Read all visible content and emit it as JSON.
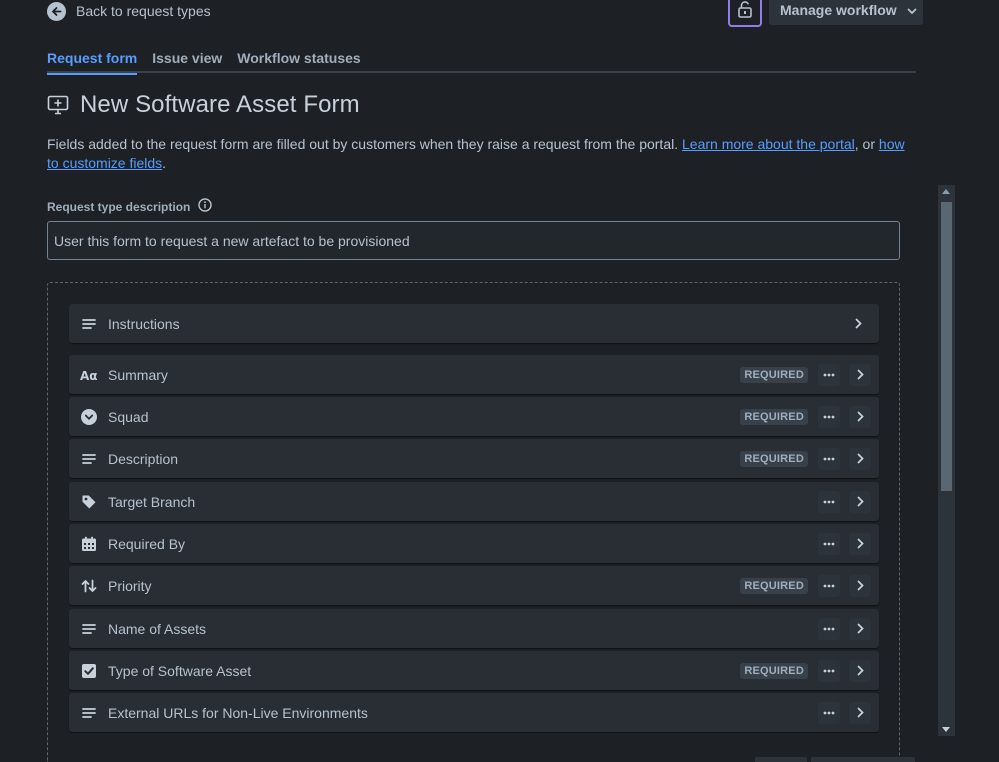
{
  "header": {
    "back_label": "Back to request types",
    "manage_workflow_label": "Manage workflow"
  },
  "tabs": [
    {
      "label": "Request form",
      "active": true
    },
    {
      "label": "Issue view",
      "active": false
    },
    {
      "label": "Workflow statuses",
      "active": false
    }
  ],
  "page": {
    "title": "New Software Asset Form",
    "intro_text": "Fields added to the request form are filled out by customers when they raise a request from the portal. ",
    "intro_link1": "Learn more about the portal",
    "intro_mid": ", or ",
    "intro_link2": "how to customize fields",
    "intro_end": "."
  },
  "description": {
    "label": "Request type description",
    "value": "User this form to request a new artefact to be provisioned"
  },
  "instructions": {
    "label": "Instructions",
    "icon": "text-lines-icon"
  },
  "fields": [
    {
      "label": "Summary",
      "icon": "text-format-icon",
      "required": "REQUIRED"
    },
    {
      "label": "Squad",
      "icon": "dropdown-circle-icon",
      "required": "REQUIRED"
    },
    {
      "label": "Description",
      "icon": "text-lines-icon",
      "required": "REQUIRED"
    },
    {
      "label": "Target Branch",
      "icon": "tag-icon",
      "required": ""
    },
    {
      "label": "Required By",
      "icon": "calendar-icon",
      "required": ""
    },
    {
      "label": "Priority",
      "icon": "priority-arrows-icon",
      "required": "REQUIRED"
    },
    {
      "label": "Name of Assets",
      "icon": "text-lines-icon",
      "required": ""
    },
    {
      "label": "Type of Software Asset",
      "icon": "checkbox-icon",
      "required": "REQUIRED"
    },
    {
      "label": "External URLs for Non-Live Environments",
      "icon": "text-lines-icon",
      "required": ""
    }
  ],
  "colors": {
    "background": "#1d2125",
    "accent": "#579dff",
    "lock_border": "#8f7ee7"
  }
}
